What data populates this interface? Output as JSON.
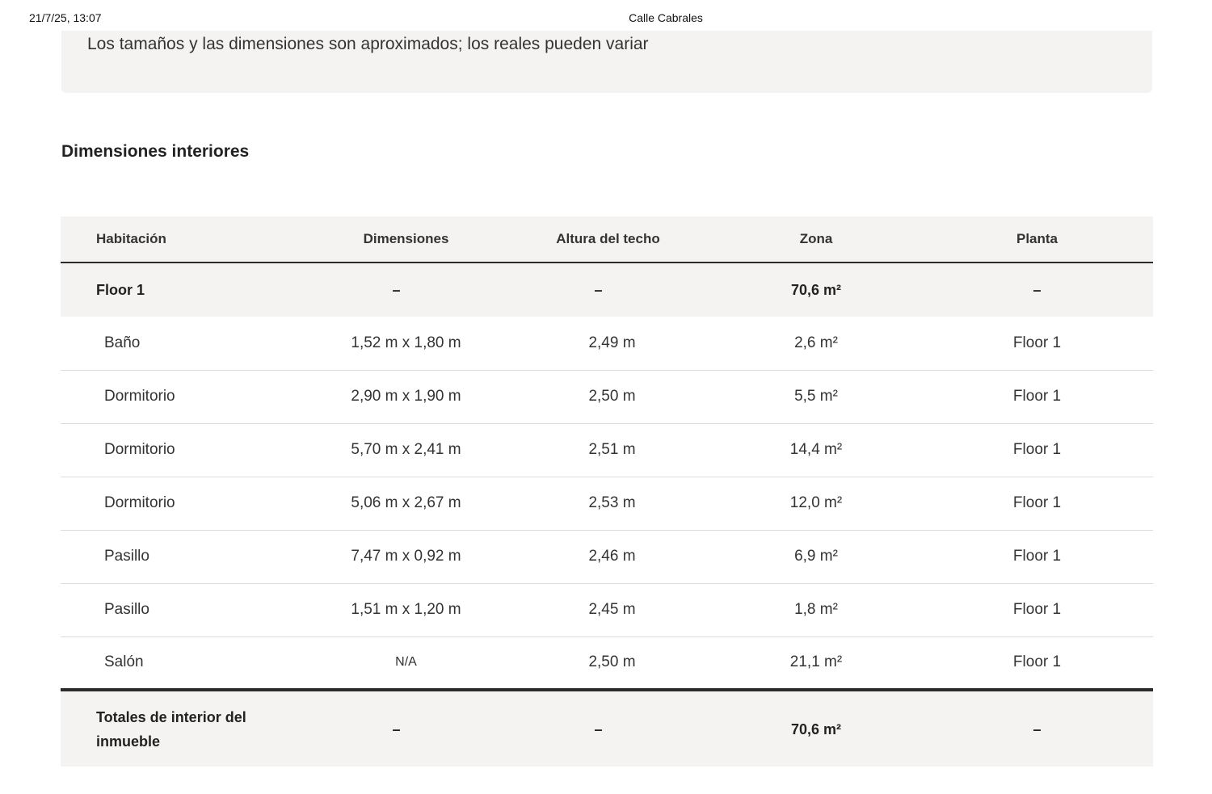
{
  "print_header": {
    "date": "21/7/25, 13:07",
    "title": "Calle Cabrales"
  },
  "disclaimer": "Los tamaños y las dimensiones son aproximados; los reales pueden variar",
  "section_title": "Dimensiones interiores",
  "table": {
    "headers": {
      "room": "Habitación",
      "dimensions": "Dimensiones",
      "ceiling": "Altura del techo",
      "area": "Zona",
      "floor": "Planta"
    },
    "group": {
      "room": "Floor 1",
      "dimensions": "–",
      "ceiling": "–",
      "area": "70,6 m²",
      "floor": "–"
    },
    "rows": [
      {
        "room": "Baño",
        "dimensions": "1,52 m x 1,80 m",
        "ceiling": "2,49 m",
        "area": "2,6 m²",
        "floor": "Floor 1"
      },
      {
        "room": "Dormitorio",
        "dimensions": "2,90 m x 1,90 m",
        "ceiling": "2,50 m",
        "area": "5,5 m²",
        "floor": "Floor 1"
      },
      {
        "room": "Dormitorio",
        "dimensions": "5,70 m x 2,41 m",
        "ceiling": "2,51 m",
        "area": "14,4 m²",
        "floor": "Floor 1"
      },
      {
        "room": "Dormitorio",
        "dimensions": "5,06 m x 2,67 m",
        "ceiling": "2,53 m",
        "area": "12,0 m²",
        "floor": "Floor 1"
      },
      {
        "room": "Pasillo",
        "dimensions": "7,47 m x 0,92 m",
        "ceiling": "2,46 m",
        "area": "6,9 m²",
        "floor": "Floor 1"
      },
      {
        "room": "Pasillo",
        "dimensions": "1,51 m x 1,20 m",
        "ceiling": "2,45 m",
        "area": "1,8 m²",
        "floor": "Floor 1"
      },
      {
        "room": "Salón",
        "dimensions": "N/A",
        "ceiling": "2,50 m",
        "area": "21,1 m²",
        "floor": "Floor 1"
      }
    ],
    "totals": {
      "room_line1": "Totales de interior del",
      "room_line2": "inmueble",
      "dimensions": "–",
      "ceiling": "–",
      "area": "70,6 m²",
      "floor": "–"
    }
  }
}
